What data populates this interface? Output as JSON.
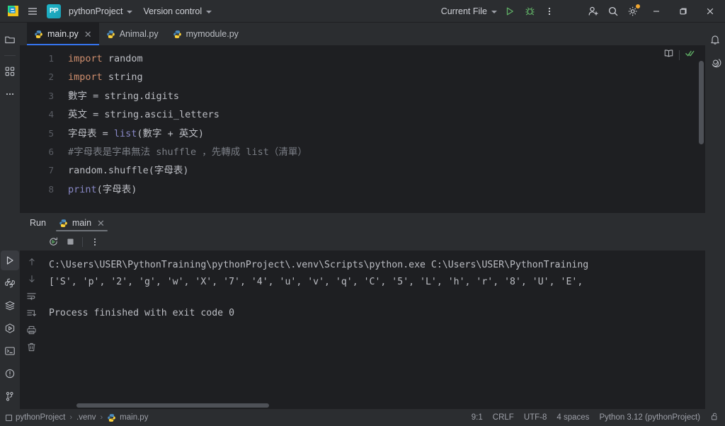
{
  "titlebar": {
    "app_icon": "pycharm-logo-icon",
    "menu_icon": "hamburger-menu-icon",
    "project_badge": "PP",
    "project_name": "pythonProject",
    "version_control": "Version control",
    "run_config": "Current File",
    "run_icon": "run-icon",
    "debug_icon": "debug-icon",
    "more_icon": "more-options-icon",
    "account_icon": "add-account-icon",
    "search_icon": "search-icon",
    "settings_icon": "gear-icon",
    "minimize_icon": "minimize-icon",
    "maximize_icon": "maximize-icon",
    "close_icon": "close-icon"
  },
  "left_strip": {
    "items": [
      {
        "name": "project-tool-window",
        "icon": "folder-icon"
      },
      {
        "name": "structure-tool-window",
        "icon": "structure-icon"
      },
      {
        "name": "more-tool-windows",
        "icon": "ellipsis-icon"
      }
    ],
    "bottom_items": [
      {
        "name": "run-tool-window",
        "icon": "run-triangle-icon",
        "active": true
      },
      {
        "name": "python-console-tool-window",
        "icon": "python-icon"
      },
      {
        "name": "services-tool-window",
        "icon": "layers-icon"
      },
      {
        "name": "python-packages-tool-window",
        "icon": "hex-run-icon"
      },
      {
        "name": "terminal-tool-window",
        "icon": "terminal-icon"
      },
      {
        "name": "problems-tool-window",
        "icon": "warning-circle-icon"
      },
      {
        "name": "version-control-tool-window",
        "icon": "branch-icon"
      }
    ]
  },
  "right_strip": {
    "items": [
      {
        "name": "notifications",
        "icon": "bell-icon"
      },
      {
        "name": "ai-assistant",
        "icon": "spiral-icon"
      }
    ]
  },
  "tabs": [
    {
      "label": "main.py",
      "icon": "python-file-icon",
      "active": true,
      "closable": true
    },
    {
      "label": "Animal.py",
      "icon": "python-file-icon",
      "active": false,
      "closable": false
    },
    {
      "label": "mymodule.py",
      "icon": "python-file-icon",
      "active": false,
      "closable": false
    }
  ],
  "editor": {
    "line_numbers": [
      "1",
      "2",
      "3",
      "4",
      "5",
      "6",
      "7",
      "8"
    ],
    "lines": [
      {
        "n": 1,
        "tokens": [
          {
            "t": "import",
            "c": "kw"
          },
          {
            "t": " random",
            "c": "plain"
          }
        ]
      },
      {
        "n": 2,
        "tokens": [
          {
            "t": "import",
            "c": "kw"
          },
          {
            "t": " string",
            "c": "plain"
          }
        ]
      },
      {
        "n": 3,
        "tokens": [
          {
            "t": "數字 = string.digits",
            "c": "plain"
          }
        ]
      },
      {
        "n": 4,
        "tokens": [
          {
            "t": "英文 = string.ascii_letters",
            "c": "plain"
          }
        ]
      },
      {
        "n": 5,
        "tokens": [
          {
            "t": "字母表 = ",
            "c": "plain"
          },
          {
            "t": "list",
            "c": "builtin"
          },
          {
            "t": "(數字 + 英文)",
            "c": "plain"
          }
        ]
      },
      {
        "n": 6,
        "tokens": [
          {
            "t": "#字母表是字串無法 shuffle ，先轉成 list（清單）",
            "c": "comment"
          }
        ]
      },
      {
        "n": 7,
        "tokens": [
          {
            "t": "random.shuffle(字母表)",
            "c": "plain"
          }
        ]
      },
      {
        "n": 8,
        "tokens": [
          {
            "t": "print",
            "c": "fn-print"
          },
          {
            "t": "(字母表)",
            "c": "plain"
          }
        ]
      }
    ],
    "top_right_icons": [
      {
        "name": "reader-mode-icon",
        "glyph": "book"
      },
      {
        "name": "inspections-ok-icon",
        "glyph": "double-check"
      }
    ]
  },
  "run_panel": {
    "title": "Run",
    "tab_label": "main",
    "tab_icon": "python-file-icon",
    "tab_close_icon": "close-icon",
    "toolbar": [
      {
        "name": "rerun-button",
        "icon": "rerun-icon"
      },
      {
        "name": "stop-button",
        "icon": "stop-icon"
      },
      {
        "name": "run-more-options",
        "icon": "more-options-icon"
      }
    ],
    "gutter": [
      {
        "name": "previous-occurrence-button",
        "icon": "arrow-up-icon"
      },
      {
        "name": "next-occurrence-button",
        "icon": "arrow-down-icon"
      },
      {
        "name": "soft-wrap-button",
        "icon": "soft-wrap-icon"
      },
      {
        "name": "scroll-to-end-button",
        "icon": "scroll-end-icon"
      },
      {
        "name": "print-button",
        "icon": "print-icon"
      },
      {
        "name": "clear-all-button",
        "icon": "trash-icon"
      }
    ],
    "console": {
      "command_line": "C:\\Users\\USER\\PythonTraining\\pythonProject\\.venv\\Scripts\\python.exe C:\\Users\\USER\\PythonTraining",
      "output_line": "['S', 'p', '2', 'g', 'w', 'X', '7', '4', 'u', 'v', 'q', 'C', '5', 'L', 'h', 'r', '8', 'U', 'E',",
      "exit_line": "Process finished with exit code 0"
    }
  },
  "statusbar": {
    "breadcrumb": [
      {
        "label": "pythonProject",
        "icon": "project-square-icon"
      },
      {
        "label": ".venv",
        "icon": ""
      },
      {
        "label": "main.py",
        "icon": "python-file-icon"
      }
    ],
    "separator": "›",
    "caret_position": "9:1",
    "line_separator": "CRLF",
    "encoding": "UTF-8",
    "indent": "4 spaces",
    "interpreter": "Python 3.12 (pythonProject)",
    "lock_icon": "unlocked-icon"
  },
  "colors": {
    "bg_editor": "#1e1f22",
    "bg_chrome": "#2b2d30",
    "accent_tab": "#3574f0",
    "keyword": "#cf8e6d",
    "builtin": "#8888c6",
    "comment": "#7a7e85",
    "text": "#bcbec4",
    "run_green": "#5fad65",
    "badge_orange": "#f0a732"
  }
}
